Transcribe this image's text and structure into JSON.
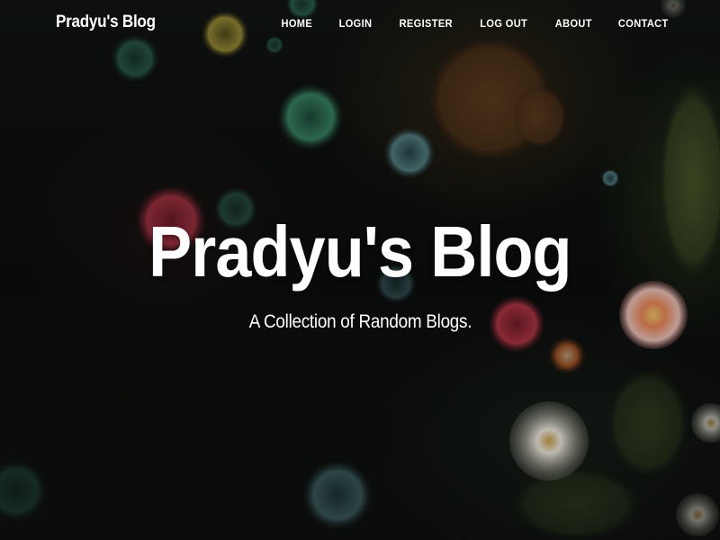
{
  "navbar": {
    "brand": "Pradyu's Blog",
    "links": [
      {
        "label": "HOME"
      },
      {
        "label": "LOGIN"
      },
      {
        "label": "REGISTER"
      },
      {
        "label": "LOG OUT"
      },
      {
        "label": "ABOUT"
      },
      {
        "label": "CONTACT"
      }
    ]
  },
  "header": {
    "title": "Pradyu's Blog",
    "subtitle": "A Collection of Random Blogs."
  },
  "background": {
    "image": "sea-anemones-aquarium-photo"
  }
}
